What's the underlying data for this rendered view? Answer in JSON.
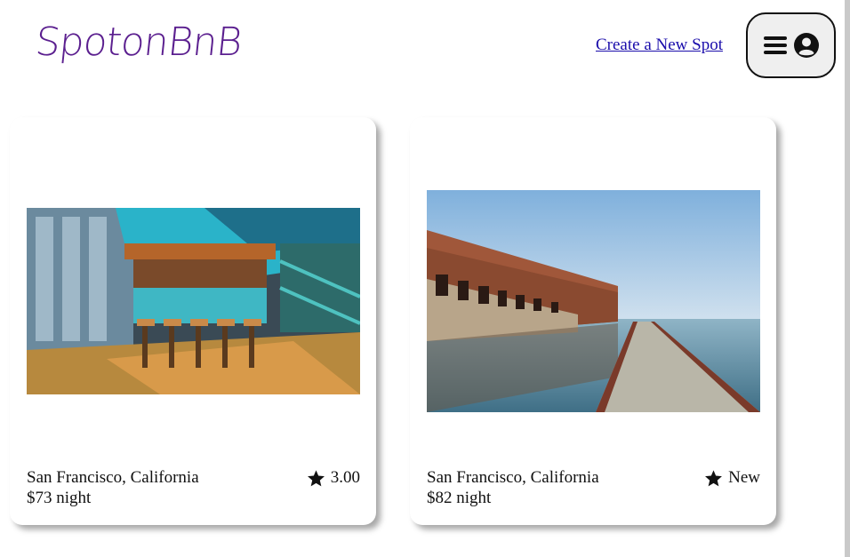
{
  "header": {
    "logo_text": "SpotonBnB",
    "create_link": "Create a New Spot",
    "menu_icon": "hamburger-icon",
    "profile_icon": "user-circle-icon"
  },
  "spots": [
    {
      "image": "restaurant-bar-interior-photo",
      "location": "San Francisco, California",
      "price": "$73 night",
      "rating": "3.00",
      "star_icon": "star-icon"
    },
    {
      "image": "brick-fort-waterfront-photo",
      "location": "San Francisco, California",
      "price": "$82 night",
      "rating": "New",
      "star_icon": "star-icon"
    }
  ],
  "colors": {
    "logo": "#5b1f8f",
    "link": "#1a0dab"
  }
}
